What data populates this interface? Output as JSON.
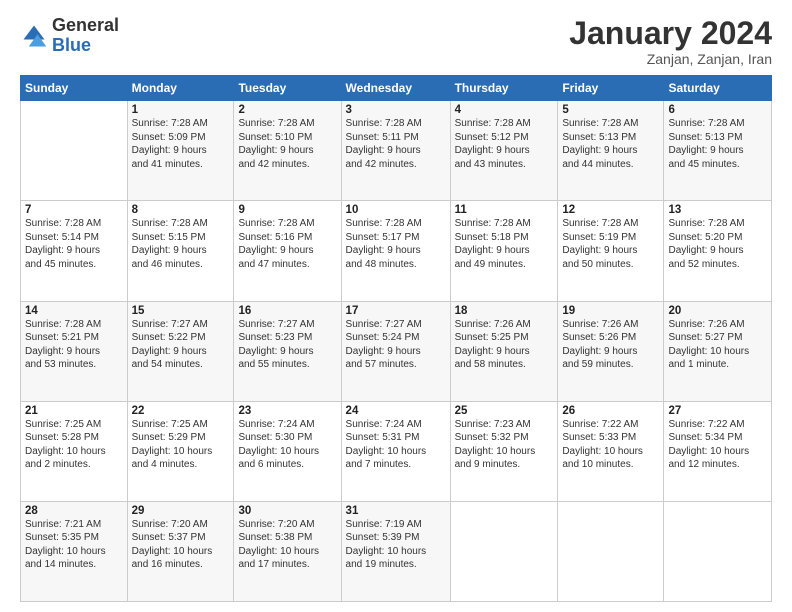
{
  "header": {
    "logo_general": "General",
    "logo_blue": "Blue",
    "month_title": "January 2024",
    "subtitle": "Zanjan, Zanjan, Iran"
  },
  "days_of_week": [
    "Sunday",
    "Monday",
    "Tuesday",
    "Wednesday",
    "Thursday",
    "Friday",
    "Saturday"
  ],
  "weeks": [
    [
      {
        "day": "",
        "info": ""
      },
      {
        "day": "1",
        "info": "Sunrise: 7:28 AM\nSunset: 5:09 PM\nDaylight: 9 hours\nand 41 minutes."
      },
      {
        "day": "2",
        "info": "Sunrise: 7:28 AM\nSunset: 5:10 PM\nDaylight: 9 hours\nand 42 minutes."
      },
      {
        "day": "3",
        "info": "Sunrise: 7:28 AM\nSunset: 5:11 PM\nDaylight: 9 hours\nand 42 minutes."
      },
      {
        "day": "4",
        "info": "Sunrise: 7:28 AM\nSunset: 5:12 PM\nDaylight: 9 hours\nand 43 minutes."
      },
      {
        "day": "5",
        "info": "Sunrise: 7:28 AM\nSunset: 5:13 PM\nDaylight: 9 hours\nand 44 minutes."
      },
      {
        "day": "6",
        "info": "Sunrise: 7:28 AM\nSunset: 5:13 PM\nDaylight: 9 hours\nand 45 minutes."
      }
    ],
    [
      {
        "day": "7",
        "info": "Sunrise: 7:28 AM\nSunset: 5:14 PM\nDaylight: 9 hours\nand 45 minutes."
      },
      {
        "day": "8",
        "info": "Sunrise: 7:28 AM\nSunset: 5:15 PM\nDaylight: 9 hours\nand 46 minutes."
      },
      {
        "day": "9",
        "info": "Sunrise: 7:28 AM\nSunset: 5:16 PM\nDaylight: 9 hours\nand 47 minutes."
      },
      {
        "day": "10",
        "info": "Sunrise: 7:28 AM\nSunset: 5:17 PM\nDaylight: 9 hours\nand 48 minutes."
      },
      {
        "day": "11",
        "info": "Sunrise: 7:28 AM\nSunset: 5:18 PM\nDaylight: 9 hours\nand 49 minutes."
      },
      {
        "day": "12",
        "info": "Sunrise: 7:28 AM\nSunset: 5:19 PM\nDaylight: 9 hours\nand 50 minutes."
      },
      {
        "day": "13",
        "info": "Sunrise: 7:28 AM\nSunset: 5:20 PM\nDaylight: 9 hours\nand 52 minutes."
      }
    ],
    [
      {
        "day": "14",
        "info": "Sunrise: 7:28 AM\nSunset: 5:21 PM\nDaylight: 9 hours\nand 53 minutes."
      },
      {
        "day": "15",
        "info": "Sunrise: 7:27 AM\nSunset: 5:22 PM\nDaylight: 9 hours\nand 54 minutes."
      },
      {
        "day": "16",
        "info": "Sunrise: 7:27 AM\nSunset: 5:23 PM\nDaylight: 9 hours\nand 55 minutes."
      },
      {
        "day": "17",
        "info": "Sunrise: 7:27 AM\nSunset: 5:24 PM\nDaylight: 9 hours\nand 57 minutes."
      },
      {
        "day": "18",
        "info": "Sunrise: 7:26 AM\nSunset: 5:25 PM\nDaylight: 9 hours\nand 58 minutes."
      },
      {
        "day": "19",
        "info": "Sunrise: 7:26 AM\nSunset: 5:26 PM\nDaylight: 9 hours\nand 59 minutes."
      },
      {
        "day": "20",
        "info": "Sunrise: 7:26 AM\nSunset: 5:27 PM\nDaylight: 10 hours\nand 1 minute."
      }
    ],
    [
      {
        "day": "21",
        "info": "Sunrise: 7:25 AM\nSunset: 5:28 PM\nDaylight: 10 hours\nand 2 minutes."
      },
      {
        "day": "22",
        "info": "Sunrise: 7:25 AM\nSunset: 5:29 PM\nDaylight: 10 hours\nand 4 minutes."
      },
      {
        "day": "23",
        "info": "Sunrise: 7:24 AM\nSunset: 5:30 PM\nDaylight: 10 hours\nand 6 minutes."
      },
      {
        "day": "24",
        "info": "Sunrise: 7:24 AM\nSunset: 5:31 PM\nDaylight: 10 hours\nand 7 minutes."
      },
      {
        "day": "25",
        "info": "Sunrise: 7:23 AM\nSunset: 5:32 PM\nDaylight: 10 hours\nand 9 minutes."
      },
      {
        "day": "26",
        "info": "Sunrise: 7:22 AM\nSunset: 5:33 PM\nDaylight: 10 hours\nand 10 minutes."
      },
      {
        "day": "27",
        "info": "Sunrise: 7:22 AM\nSunset: 5:34 PM\nDaylight: 10 hours\nand 12 minutes."
      }
    ],
    [
      {
        "day": "28",
        "info": "Sunrise: 7:21 AM\nSunset: 5:35 PM\nDaylight: 10 hours\nand 14 minutes."
      },
      {
        "day": "29",
        "info": "Sunrise: 7:20 AM\nSunset: 5:37 PM\nDaylight: 10 hours\nand 16 minutes."
      },
      {
        "day": "30",
        "info": "Sunrise: 7:20 AM\nSunset: 5:38 PM\nDaylight: 10 hours\nand 17 minutes."
      },
      {
        "day": "31",
        "info": "Sunrise: 7:19 AM\nSunset: 5:39 PM\nDaylight: 10 hours\nand 19 minutes."
      },
      {
        "day": "",
        "info": ""
      },
      {
        "day": "",
        "info": ""
      },
      {
        "day": "",
        "info": ""
      }
    ]
  ]
}
